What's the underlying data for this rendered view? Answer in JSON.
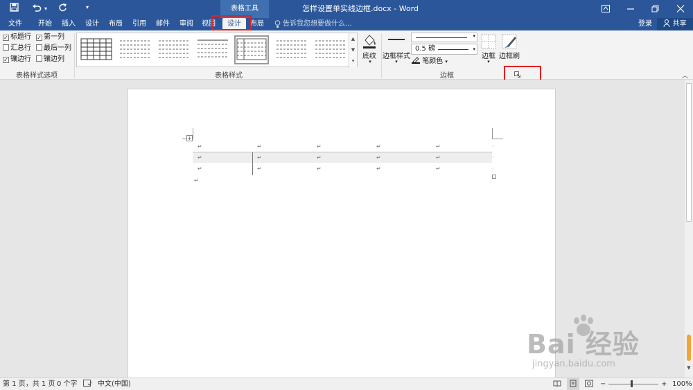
{
  "titlebar": {
    "contextual_tools": "表格工具",
    "document_title": "怎样设置单实线边框.docx - Word"
  },
  "tabs": [
    {
      "label": "文件"
    },
    {
      "label": "开始"
    },
    {
      "label": "插入"
    },
    {
      "label": "设计"
    },
    {
      "label": "布局"
    },
    {
      "label": "引用"
    },
    {
      "label": "邮件"
    },
    {
      "label": "审阅"
    },
    {
      "label": "视图"
    },
    {
      "label": "设计",
      "active": true
    },
    {
      "label": "布局"
    }
  ],
  "tell_me": "告诉我您想要做什么...",
  "account": {
    "login": "登录",
    "share": "共享"
  },
  "ribbon": {
    "style_options": {
      "header_row": "标题行",
      "first_column": "第一列",
      "total_row": "汇总行",
      "last_column": "最后一列",
      "banded_rows": "镶边行",
      "banded_columns": "镶边列",
      "label": "表格样式选项",
      "checked": {
        "header_row": true,
        "first_column": true,
        "total_row": false,
        "last_column": false,
        "banded_rows": true,
        "banded_columns": false
      }
    },
    "table_styles": {
      "label": "表格样式",
      "shading": "底纹"
    },
    "borders": {
      "border_styles": "边框样式",
      "pen_weight": "0.5 磅",
      "pen_color": "笔颜色",
      "borders_btn": "边框",
      "border_painter": "边框刷",
      "label": "边框"
    }
  },
  "statusbar": {
    "page": "第 1 页，共 1 页",
    "words": "0 个字",
    "language": "中文(中国)",
    "zoom": "100%"
  },
  "watermark": {
    "brand": "Bai 经验",
    "url": "jingyan.baidu.com"
  },
  "colors": {
    "title_blue": "#2b579a",
    "highlight_red": "#e02020"
  }
}
